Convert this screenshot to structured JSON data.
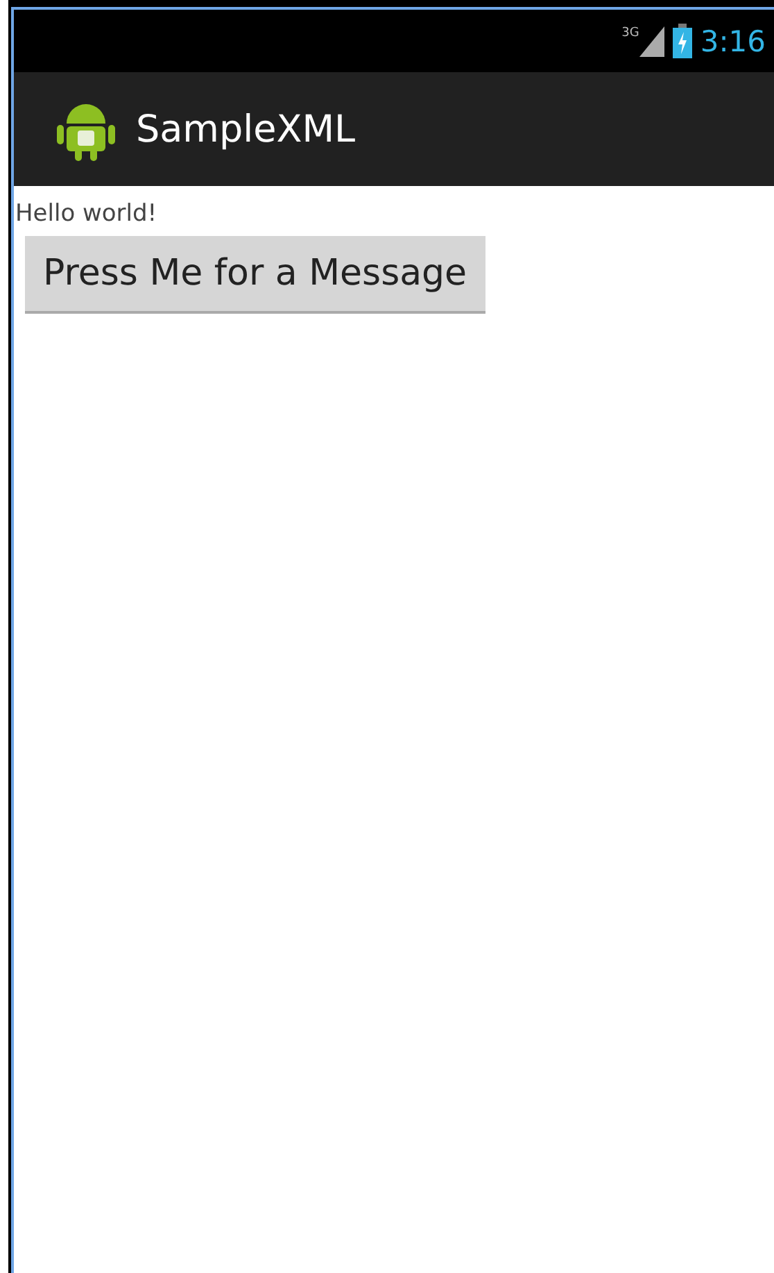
{
  "status_bar": {
    "network": "3G",
    "time": "3:16"
  },
  "action_bar": {
    "title": "SampleXML"
  },
  "content": {
    "text": "Hello world!",
    "button": "Press Me for a Message"
  }
}
